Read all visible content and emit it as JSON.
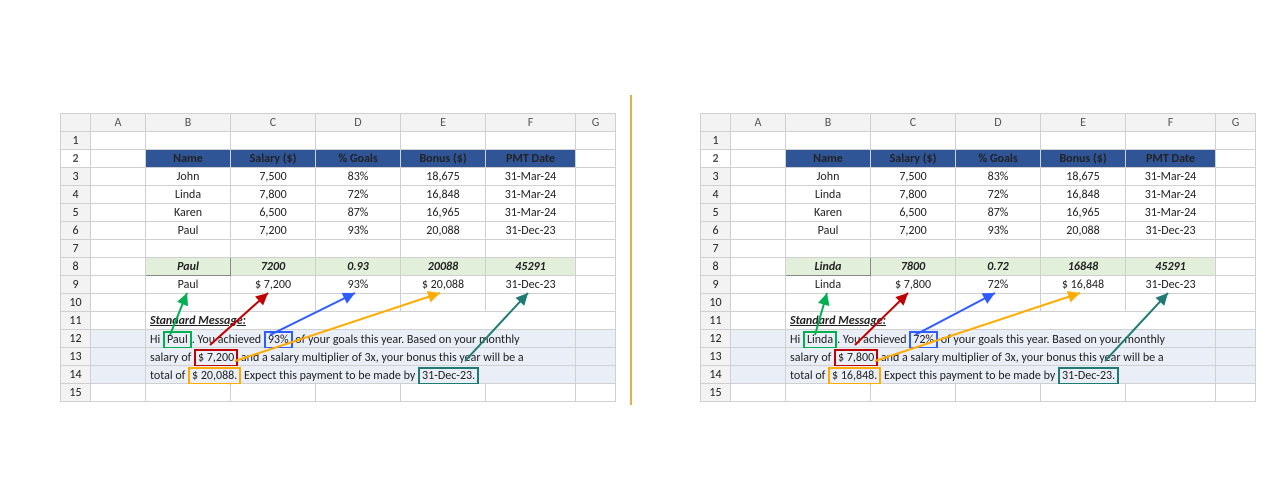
{
  "columns": [
    "A",
    "B",
    "C",
    "D",
    "E",
    "F",
    "G"
  ],
  "rows": [
    "1",
    "2",
    "3",
    "4",
    "5",
    "6",
    "7",
    "8",
    "9",
    "10",
    "11",
    "12",
    "13",
    "14",
    "15"
  ],
  "header": {
    "name": "Name",
    "salary": "Salary ($)",
    "goals": "% Goals",
    "bonus": "Bonus ($)",
    "pmt": "PMT Date"
  },
  "data": [
    {
      "name": "John",
      "salary": "7,500",
      "goals": "83%",
      "bonus": "18,675",
      "pmt": "31-Mar-24"
    },
    {
      "name": "Linda",
      "salary": "7,800",
      "goals": "72%",
      "bonus": "16,848",
      "pmt": "31-Mar-24"
    },
    {
      "name": "Karen",
      "salary": "6,500",
      "goals": "87%",
      "bonus": "16,965",
      "pmt": "31-Mar-24"
    },
    {
      "name": "Paul",
      "salary": "7,200",
      "goals": "93%",
      "bonus": "20,088",
      "pmt": "31-Dec-23"
    }
  ],
  "left": {
    "raw": {
      "name": "Paul",
      "salary": "7200",
      "goals": "0.93",
      "bonus": "20088",
      "pmt": "45291"
    },
    "fmt": {
      "name": "Paul",
      "salary": "$ 7,200",
      "goals": "93%",
      "bonus": "$ 20,088",
      "pmt": "31-Dec-23"
    },
    "msgHeader": "Standard Message:",
    "msg": {
      "pre1": "Hi ",
      "name": "Paul",
      "mid1": ". You achieved ",
      "pct": "93%",
      "mid2": " of your goals this year. Based on your monthly",
      "pre2": "salary of ",
      "sal": "$ 7,200",
      "mid3": " and a salary multiplier of 3x, your bonus this year will be a",
      "pre3": "total of ",
      "bonus": "$ 20,088.",
      "mid4": " Expect this payment to be made by ",
      "date": "31-Dec-23."
    }
  },
  "right": {
    "raw": {
      "name": "Linda",
      "salary": "7800",
      "goals": "0.72",
      "bonus": "16848",
      "pmt": "45291"
    },
    "fmt": {
      "name": "Linda",
      "salary": "$ 7,800",
      "goals": "72%",
      "bonus": "$ 16,848",
      "pmt": "31-Dec-23"
    },
    "msgHeader": "Standard Message:",
    "msg": {
      "pre1": "Hi ",
      "name": "Linda",
      "mid1": ". You achieved ",
      "pct": "72%",
      "mid2": " of your goals this year. Based on your monthly",
      "pre2": "salary of ",
      "sal": "$ 7,800",
      "mid3": " and a salary multiplier of 3x, your bonus this year will be a",
      "pre3": "total of ",
      "bonus": "$ 16,848.",
      "mid4": " Expect this payment to be made by ",
      "date": "31-Dec-23."
    }
  },
  "colors": {
    "green": "#00b050",
    "red": "#c00000",
    "blue": "#2e5cff",
    "orange": "#ffab00",
    "teal": "#1f7a74"
  }
}
